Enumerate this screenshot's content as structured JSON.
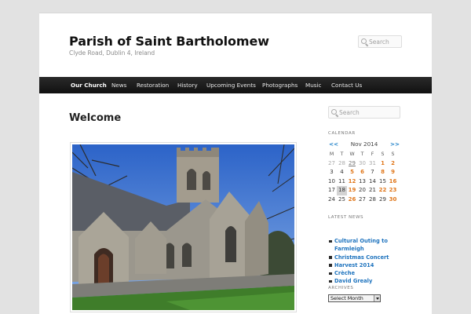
{
  "site": {
    "title": "Parish of Saint Bartholomew",
    "description": "Clyde Road, Dublin 4, Ireland"
  },
  "header_search": {
    "placeholder": "Search"
  },
  "nav": {
    "items": [
      {
        "label": "Our Church",
        "active": true
      },
      {
        "label": "News"
      },
      {
        "label": "Restoration"
      },
      {
        "label": "History"
      },
      {
        "label": "Upcoming Events"
      },
      {
        "label": "Photographs"
      },
      {
        "label": "Music"
      },
      {
        "label": "Contact Us"
      }
    ]
  },
  "main": {
    "heading": "Welcome",
    "image_icon": "church-photo"
  },
  "sidebar": {
    "search": {
      "placeholder": "Search"
    },
    "calendar": {
      "title": "Calendar",
      "prev": "<<",
      "month": "Nov 2014",
      "next": ">>",
      "weekdays": [
        "M",
        "T",
        "W",
        "T",
        "F",
        "S",
        "S"
      ],
      "weeks": [
        [
          {
            "d": "27",
            "other": true
          },
          {
            "d": "28",
            "other": true
          },
          {
            "d": "29",
            "other": true,
            "underlined": true
          },
          {
            "d": "30",
            "other": true
          },
          {
            "d": "31",
            "other": true
          },
          {
            "d": "1",
            "linked": true
          },
          {
            "d": "2",
            "linked": true
          }
        ],
        [
          {
            "d": "3"
          },
          {
            "d": "4"
          },
          {
            "d": "5",
            "linked": true
          },
          {
            "d": "6",
            "linked": true
          },
          {
            "d": "7"
          },
          {
            "d": "8",
            "linked": true
          },
          {
            "d": "9",
            "linked": true
          }
        ],
        [
          {
            "d": "10"
          },
          {
            "d": "11"
          },
          {
            "d": "12",
            "linked": true
          },
          {
            "d": "13"
          },
          {
            "d": "14"
          },
          {
            "d": "15"
          },
          {
            "d": "16",
            "linked": true
          }
        ],
        [
          {
            "d": "17"
          },
          {
            "d": "18",
            "today": true
          },
          {
            "d": "19",
            "linked": true
          },
          {
            "d": "20"
          },
          {
            "d": "21"
          },
          {
            "d": "22",
            "linked": true
          },
          {
            "d": "23",
            "linked": true
          }
        ],
        [
          {
            "d": "24"
          },
          {
            "d": "25"
          },
          {
            "d": "26",
            "linked": true
          },
          {
            "d": "27"
          },
          {
            "d": "28"
          },
          {
            "d": "29"
          },
          {
            "d": "30",
            "linked": true
          }
        ]
      ]
    },
    "latest_news": {
      "title": "Latest News",
      "items": [
        "Cultural Outing to Farmleigh",
        "Christmas Concert",
        "Harvest 2014",
        "Crèche",
        "David Grealy"
      ]
    },
    "archives": {
      "title": "Archives",
      "selected": "Select Month"
    }
  },
  "colors": {
    "nav_bg": "#1a1a1a",
    "link_blue": "#1e73be",
    "event_orange": "#e0771b",
    "page_bg": "#e2e2e2"
  }
}
